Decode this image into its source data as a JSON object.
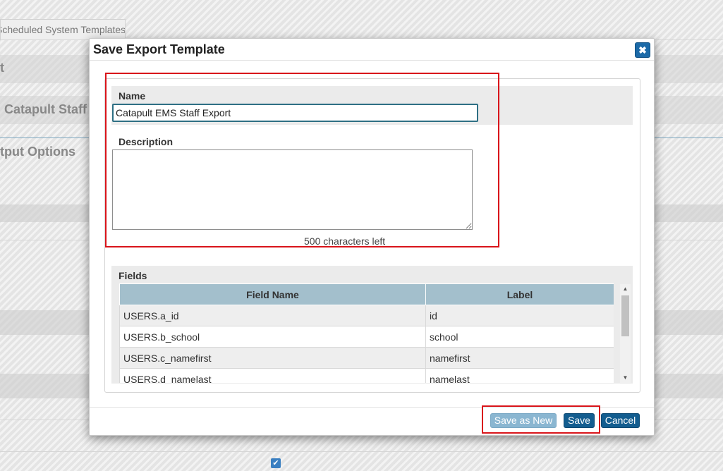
{
  "background": {
    "tab_label": "Scheduled System Templates",
    "heading_1": "t",
    "heading_2": "Catapult Staff",
    "heading_3": "tput Options"
  },
  "dialog": {
    "title": "Save Export Template",
    "close_icon": "close-icon",
    "name_label": "Name",
    "name_value": "Catapult EMS Staff Export",
    "description_label": "Description",
    "description_value": "",
    "chars_left": "500 characters left",
    "fields_label": "Fields",
    "fields_table": {
      "columns": [
        "Field Name",
        "Label"
      ],
      "rows": [
        {
          "field": "USERS.a_id",
          "label": "id"
        },
        {
          "field": "USERS.b_school",
          "label": "school"
        },
        {
          "field": "USERS.c_namefirst",
          "label": "namefirst"
        },
        {
          "field": "USERS.d_namelast",
          "label": "namelast"
        }
      ]
    },
    "buttons": {
      "save_as_new": "Save as New",
      "save": "Save",
      "cancel": "Cancel"
    }
  },
  "colors": {
    "primary_button": "#135d8f",
    "disabled_button": "#8ab6d1",
    "table_header": "#a3bfcc",
    "highlight": "#d9141a"
  }
}
